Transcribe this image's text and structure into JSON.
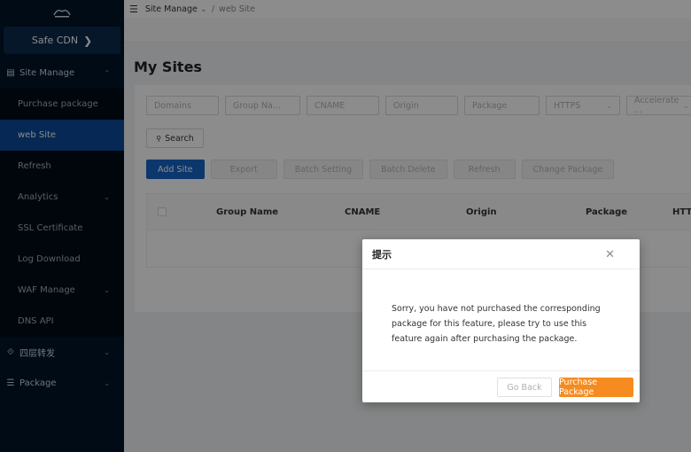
{
  "sidebar": {
    "brand_label": "Safe CDN",
    "brand_chevron": "❯",
    "items": [
      {
        "label": "Site Manage",
        "icon": "document-icon",
        "glyph": "▤",
        "arrow": "⌃"
      },
      {
        "label": "Purchase package"
      },
      {
        "label": "web Site"
      },
      {
        "label": "Refresh"
      },
      {
        "label": "Analytics",
        "arrow": "⌄"
      },
      {
        "label": "SSL Certificate"
      },
      {
        "label": "Log Download"
      },
      {
        "label": "WAF Manage",
        "arrow": "⌄"
      },
      {
        "label": "DNS API"
      },
      {
        "label": "四层转发",
        "icon": "layer-icon",
        "glyph": "⟐",
        "arrow": "⌄"
      },
      {
        "label": "Package",
        "icon": "list-icon",
        "glyph": "☰",
        "arrow": "⌄"
      }
    ]
  },
  "header": {
    "menu_glyph": "☰",
    "breadcrumb_parent": "Site Manage",
    "breadcrumb_parent_arrow": "⌄",
    "breadcrumb_sep": "/",
    "breadcrumb_current": "web Site"
  },
  "page": {
    "title": "My Sites"
  },
  "filters": {
    "domains": "Domains",
    "group_name": "Group Na...",
    "cname": "CNAME",
    "origin": "Origin",
    "package": "Package",
    "https": "HTTPS",
    "https_arrow": "⌄",
    "accelerate": "Accelerate ...",
    "accelerate_arrow": "⌄"
  },
  "search": {
    "label": "Search",
    "glyph": "⚲"
  },
  "actions": {
    "add_site": "Add Site",
    "export": "Export",
    "batch_setting": "Batch Setting",
    "batch_delete": "Batch Delete",
    "refresh": "Refresh",
    "change_package": "Change Package"
  },
  "table": {
    "headers": [
      "Group Name",
      "CNAME",
      "Origin",
      "Package",
      "HTTI"
    ]
  },
  "modal": {
    "title": "提示",
    "close_glyph": "✕",
    "message": "Sorry, you have not purchased the corresponding package for this feature, please try to use this feature again after purchasing the package.",
    "go_back": "Go Back",
    "purchase": "Purchase Package"
  },
  "colors": {
    "sidebar_bg": "#001529",
    "active_item": "#0a4a9a",
    "primary": "#1765c7",
    "accent_orange": "#f68b1f"
  }
}
